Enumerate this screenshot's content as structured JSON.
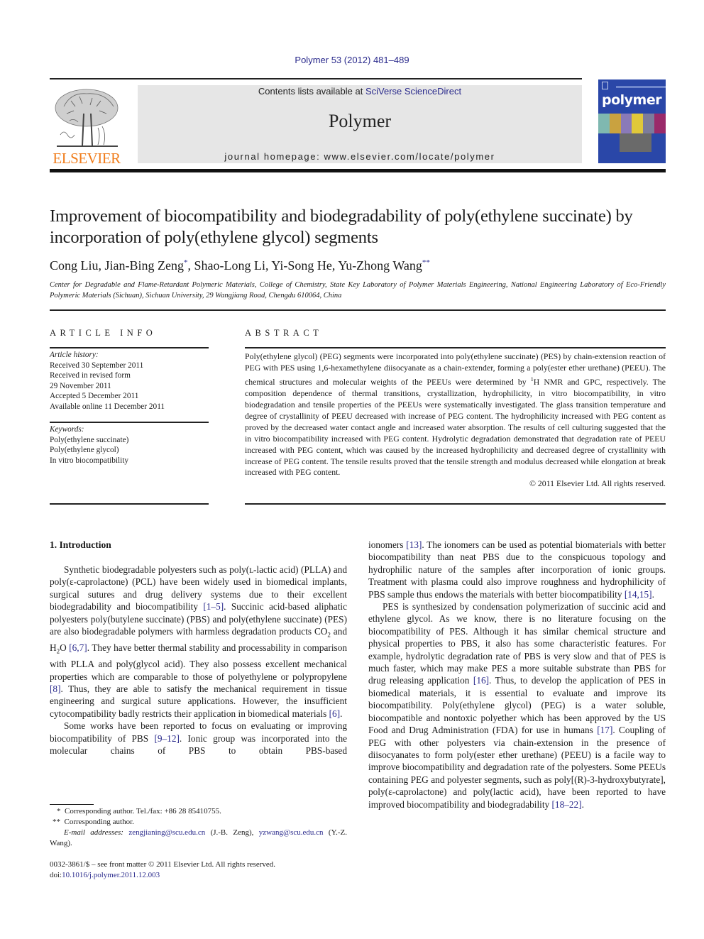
{
  "journal_citation": "Polymer 53 (2012) 481–489",
  "masthead": {
    "contents_prefix": "Contents lists available at ",
    "contents_link": "SciVerse ScienceDirect",
    "journal_title": "Polymer",
    "homepage": "journal homepage: www.elsevier.com/locate/polymer"
  },
  "publisher_logo": {
    "name": "ELSEVIER",
    "icon": "elsevier-tree-icon",
    "color": "#f07d1c"
  },
  "cover": {
    "word": "polymer",
    "color": "#2a47a8"
  },
  "article": {
    "title": "Improvement of biocompatibility and biodegradability of poly(ethylene succinate) by incorporation of poly(ethylene glycol) segments",
    "authors": [
      {
        "name": "Cong Liu",
        "mark": ""
      },
      {
        "name": "Jian-Bing Zeng",
        "mark": "*"
      },
      {
        "name": "Shao-Long Li",
        "mark": ""
      },
      {
        "name": "Yi-Song He",
        "mark": ""
      },
      {
        "name": "Yu-Zhong Wang",
        "mark": "**"
      }
    ],
    "affiliation": "Center for Degradable and Flame-Retardant Polymeric Materials, College of Chemistry, State Key Laboratory of Polymer Materials Engineering, National Engineering Laboratory of Eco-Friendly Polymeric Materials (Sichuan), Sichuan University, 29 Wangjiang Road, Chengdu 610064, China"
  },
  "article_info": {
    "heading": "ARTICLE INFO",
    "history_label": "Article history:",
    "history": [
      "Received 30 September 2011",
      "Received in revised form",
      "29 November 2011",
      "Accepted 5 December 2011",
      "Available online 11 December 2011"
    ],
    "keywords_label": "Keywords:",
    "keywords": [
      "Poly(ethylene succinate)",
      "Poly(ethylene glycol)",
      "In vitro biocompatibility"
    ]
  },
  "abstract": {
    "heading": "ABSTRACT",
    "part1": "Poly(ethylene glycol) (PEG) segments were incorporated into poly(ethylene succinate) (PES) by chain-extension reaction of PEG with PES using 1,6-hexamethylene diisocyanate as a chain-extender, forming a poly(ester ether urethane) (PEEU). The chemical structures and molecular weights of the PEEUs were determined by ",
    "sup": "1",
    "part2": "H NMR and GPC, respectively. The composition dependence of thermal transitions, crystallization, hydrophilicity, in vitro biocompatibility, in vitro biodegradation and tensile properties of the PEEUs were systematically investigated. The glass transition temperature and degree of crystallinity of PEEU decreased with increase of PEG content. The hydrophilicity increased with PEG content as proved by the decreased water contact angle and increased water absorption. The results of cell culturing suggested that the in vitro biocompatibility increased with PEG content. Hydrolytic degradation demonstrated that degradation rate of PEEU increased with PEG content, which was caused by the increased hydrophilicity and decreased degree of crystallinity with increase of PEG content. The tensile results proved that the tensile strength and modulus decreased while elongation at break increased with PEG content.",
    "copyright": "© 2011 Elsevier Ltd. All rights reserved."
  },
  "introduction": {
    "heading": "1.  Introduction",
    "p1": {
      "t1": "Synthetic biodegradable polyesters such as poly(ʟ-lactic acid) (PLLA) and poly(ε-caprolactone) (PCL) have been widely used in biomedical implants, surgical sutures and drug delivery systems due to their excellent biodegradability and biocompatibility ",
      "r1": "[1–5]",
      "t2": ". Succinic acid-based aliphatic polyesters poly(butylene succinate) (PBS) and poly(ethylene succinate) (PES) are also biodegradable polymers with harmless degradation products CO",
      "sub1": "2",
      "t3": " and H",
      "sub2": "2",
      "t4": "O ",
      "r2": "[6,7]",
      "t5": ". They have better thermal stability and processability in comparison with PLLA and poly(glycol acid). They also possess excellent mechanical properties which are comparable to those of polyethylene or polypropylene ",
      "r3": "[8]",
      "t6": ". Thus, they are able to satisfy the mechanical requirement in tissue engineering and surgical suture applications. However, the insufficient cytocompatibility badly restricts their application in biomedical materials ",
      "r4": "[6]",
      "t7": "."
    },
    "p2": {
      "t1": "Some works have been reported to focus on evaluating or improving biocompatibility of PBS ",
      "r1": "[9–12]",
      "t2": ". Ionic group was incorporated into the molecular chains of PBS to obtain PBS-based ionomers ",
      "r2": "[13]",
      "t3": ". The ionomers can be used as potential biomaterials with better biocompatibility than neat PBS due to the conspicuous topology and hydrophilic nature of the samples after incorporation of ionic groups. Treatment with plasma could also improve roughness and hydrophilicity of PBS sample thus endows the materials with better biocompatibility ",
      "r3": "[14,15]",
      "t4": "."
    },
    "p2_col1": "Some works have been reported to focus on evaluating or improving biocompatibility of PBS ",
    "p2_col1_ref": "[9–12]",
    "p2_col1_tail": ". Ionic group was incorporated into the molecular chains of PBS to obtain PBS-based",
    "p2_col2_head": "ionomers ",
    "p2_col2_ref1": "[13]",
    "p2_col2_mid": ". The ionomers can be used as potential biomaterials with better biocompatibility than neat PBS due to the conspicuous topology and hydrophilic nature of the samples after incorporation of ionic groups. Treatment with plasma could also improve roughness and hydrophilicity of PBS sample thus endows the materials with better biocompatibility ",
    "p2_col2_ref2": "[14,15]",
    "p2_col2_end": ".",
    "p3": {
      "t1": "PES is synthesized by condensation polymerization of succinic acid and ethylene glycol. As we know, there is no literature focusing on the biocompatibility of PES. Although it has similar chemical structure and physical properties to PBS, it also has some characteristic features. For example, hydrolytic degradation rate of PBS is very slow and that of PES is much faster, which may make PES a more suitable substrate than PBS for drug releasing application ",
      "r1": "[16]",
      "t2": ". Thus, to develop the application of PES in biomedical materials, it is essential to evaluate and improve its biocompatibility. Poly(ethylene glycol) (PEG) is a water soluble, biocompatible and nontoxic polyether which has been approved by the US Food and Drug Administration (FDA) for use in humans ",
      "r2": "[17]",
      "t3": ". Coupling of PEG with other polyesters via chain-extension in the presence of diisocyanates to form poly(ester ether urethane) (PEEU) is a facile way to improve biocompatibility and degradation rate of the polyesters. Some PEEUs containing PEG and polyester segments, such as poly[(R)-3-hydroxybutyrate], poly(ε-caprolactone) and poly(lactic acid), have been reported to have improved biocompatibility and biodegradability ",
      "r3": "[18–22]",
      "t4": "."
    }
  },
  "footnotes": {
    "fn1_mark": "*",
    "fn1": "Corresponding author. Tel./fax: +86 28 85410755.",
    "fn2_mark": "**",
    "fn2": "Corresponding author.",
    "email_label": "E-mail addresses: ",
    "email1": "zengjianing@scu.edu.cn",
    "email1_owner": " (J.-B. Zeng), ",
    "email2": "yzwang@scu.edu.cn",
    "email2_owner": " (Y.-Z. Wang)."
  },
  "bottom": {
    "issn": "0032-3861/$ – see front matter © 2011 Elsevier Ltd. All rights reserved.",
    "doi_label": "doi:",
    "doi": "10.1016/j.polymer.2011.12.003"
  }
}
